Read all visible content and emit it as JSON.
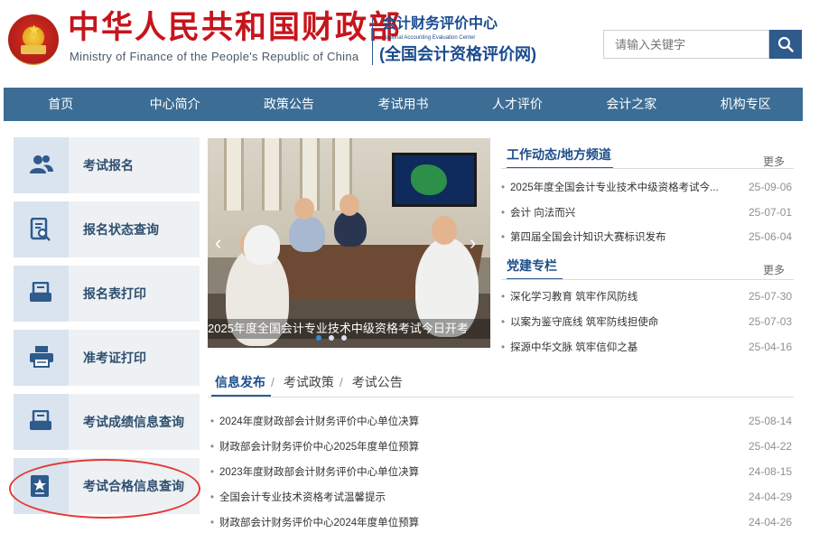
{
  "header": {
    "title_cn": "中华人民共和国财政部",
    "title_en": "Ministry of Finance of the People's Republic of China",
    "center_cn": "会计财务评价中心",
    "center_en": "National Accounting Evaluation Center",
    "center_sub": "(全国会计资格评价网)",
    "search_placeholder": "请输入关键字",
    "search_icon": "search-icon"
  },
  "nav": {
    "items": [
      "首页",
      "中心简介",
      "政策公告",
      "考试用书",
      "人才评价",
      "会计之家",
      "机构专区"
    ]
  },
  "sidebar": {
    "items": [
      {
        "label": "考试报名",
        "icon": "users-icon"
      },
      {
        "label": "报名状态查询",
        "icon": "doc-search-icon"
      },
      {
        "label": "报名表打印",
        "icon": "form-print-icon"
      },
      {
        "label": "准考证打印",
        "icon": "printer-icon"
      },
      {
        "label": "考试成绩信息查询",
        "icon": "score-doc-icon"
      },
      {
        "label": "考试合格信息查询",
        "icon": "certificate-icon"
      }
    ]
  },
  "carousel": {
    "caption": "2025年度全国会计专业技术中级资格考试今日开考",
    "slide_count": 3,
    "active_slide": 1
  },
  "work_news": {
    "title": "工作动态/地方频道",
    "more": "更多",
    "items": [
      {
        "text": "2025年度全国会计专业技术中级资格考试今...",
        "date": "25-09-06"
      },
      {
        "text": "会计 向法而兴",
        "date": "25-07-01"
      },
      {
        "text": "第四届全国会计知识大赛标识发布",
        "date": "25-06-04"
      }
    ]
  },
  "party": {
    "title": "党建专栏",
    "more": "更多",
    "items": [
      {
        "text": "深化学习教育 筑牢作风防线",
        "date": "25-07-30"
      },
      {
        "text": "以案为鉴守底线 筑牢防线担使命",
        "date": "25-07-03"
      },
      {
        "text": "探源中华文脉 筑牢信仰之基",
        "date": "25-04-16"
      }
    ]
  },
  "info": {
    "tabs": [
      "信息发布",
      "考试政策",
      "考试公告"
    ],
    "active_tab": 0,
    "items": [
      {
        "text": "2024年度财政部会计财务评价中心单位决算",
        "date": "25-08-14"
      },
      {
        "text": "财政部会计财务评价中心2025年度单位预算",
        "date": "25-04-22"
      },
      {
        "text": "2023年度财政部会计财务评价中心单位决算",
        "date": "24-08-15"
      },
      {
        "text": "全国会计专业技术资格考试温馨提示",
        "date": "24-04-29"
      },
      {
        "text": "财政部会计财务评价中心2024年度单位预算",
        "date": "24-04-26"
      }
    ]
  },
  "colors": {
    "brand_red": "#c6151c",
    "brand_blue": "#1a4b8f",
    "nav_bg": "#3c6d94",
    "highlight_oval": "#e53935"
  }
}
